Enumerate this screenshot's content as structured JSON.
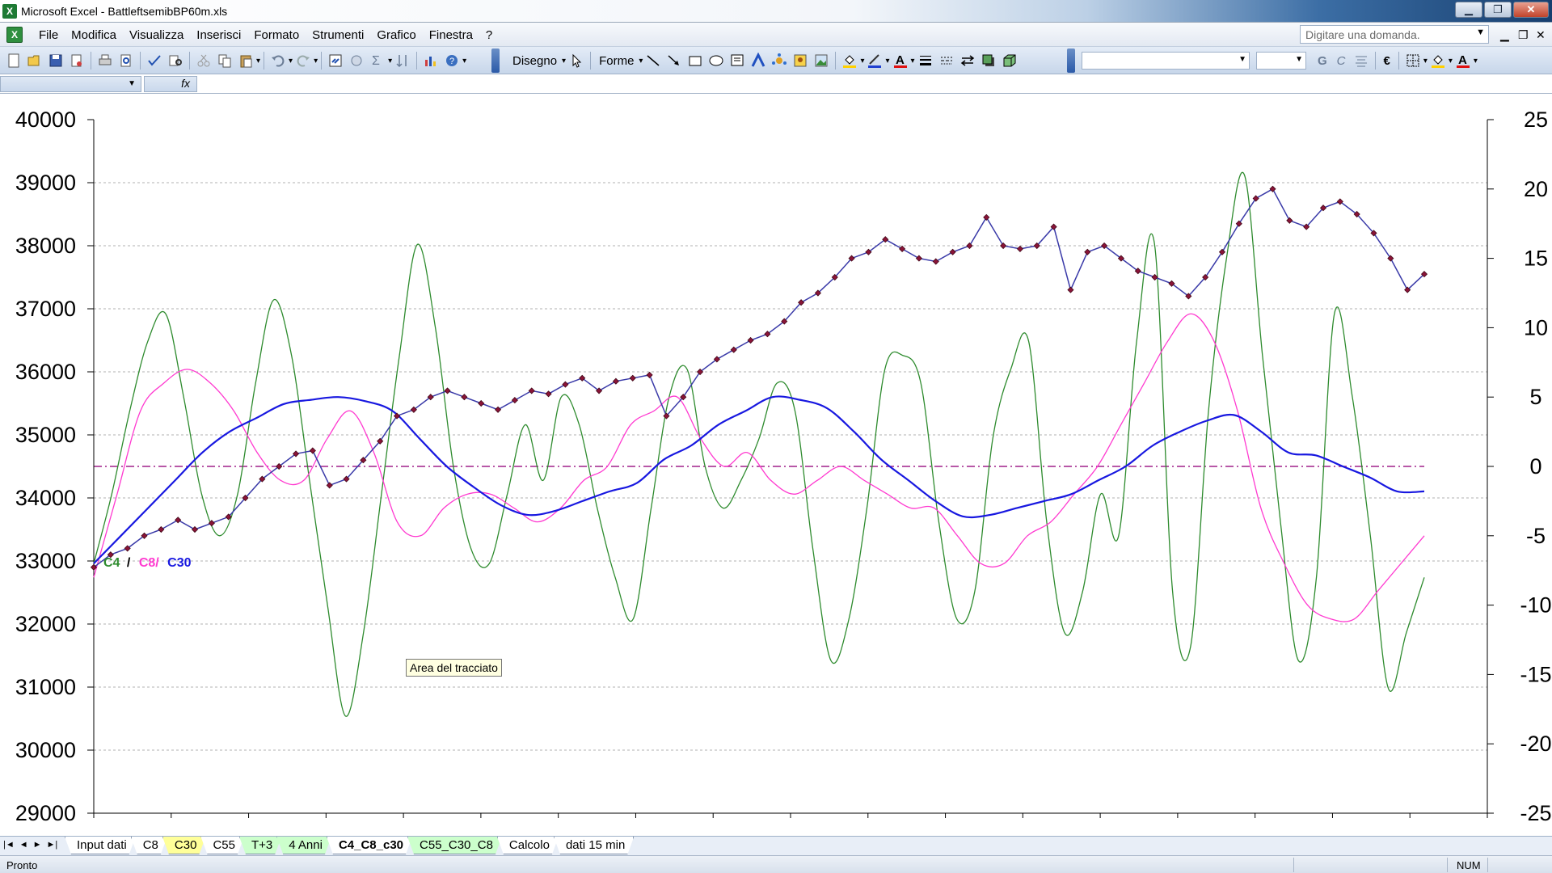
{
  "window": {
    "title": "Microsoft Excel - BattleftsemibBP60m.xls",
    "minimize": "▁",
    "restore": "❐",
    "close": "✕"
  },
  "menu": {
    "items": [
      "File",
      "Modifica",
      "Visualizza",
      "Inserisci",
      "Formato",
      "Strumenti",
      "Grafico",
      "Finestra",
      "?"
    ],
    "ask_placeholder": "Digitare una domanda.",
    "doc_min": "▁",
    "doc_restore": "❐",
    "doc_close": "✕"
  },
  "toolbar": {
    "draw_label": "Disegno",
    "shapes_label": "Forme",
    "bold": "G",
    "italic": "C",
    "euro": "€",
    "font_a": "A"
  },
  "formula_bar": {
    "fx_label": "fx"
  },
  "chart": {
    "tooltip": "Area del tracciato",
    "legend": {
      "c4": "C4",
      "sep1": "/",
      "c8": "C8/",
      "c30": "C30"
    },
    "colors": {
      "price": "#8a1438",
      "price_line": "#3a3aa8",
      "c4": "#2e8b2e",
      "c8": "#ff3ad0",
      "c30": "#1818e0",
      "zero": "#a0208a"
    }
  },
  "chart_data": {
    "type": "line",
    "left_axis": {
      "min": 29000,
      "max": 40000,
      "step": 1000,
      "ticks": [
        "40000",
        "39000",
        "38000",
        "37000",
        "36000",
        "35000",
        "34000",
        "33000",
        "32000",
        "31000",
        "30000",
        "29000"
      ]
    },
    "right_axis": {
      "min": -25,
      "max": 25,
      "step": 5,
      "ticks": [
        "25",
        "20",
        "15",
        "10",
        "5",
        "0",
        "-5",
        "-10",
        "-15",
        "-20",
        "-25"
      ]
    },
    "grid": true,
    "zero_line": 0,
    "series": [
      {
        "name": "C4",
        "axis": "right",
        "values": [
          -7,
          -2,
          4,
          9,
          11,
          5,
          -2,
          -5,
          -2,
          6,
          12,
          8,
          -1,
          -10,
          -18,
          -12,
          -2,
          8,
          16,
          10,
          0,
          -6,
          -7,
          -2,
          3,
          -1,
          5,
          3,
          -3,
          -8,
          -11,
          -3,
          5,
          7,
          0,
          -3,
          -1,
          2,
          6,
          4,
          -6,
          -14,
          -11,
          -3,
          7,
          8,
          6,
          -4,
          -11,
          -9,
          2,
          7,
          9,
          -4,
          -12,
          -9,
          -2,
          -5,
          9,
          16,
          -9,
          -13,
          4,
          15,
          21,
          8,
          -4,
          -14,
          -8,
          11,
          5,
          -5,
          -16,
          -12,
          -8
        ]
      },
      {
        "name": "C8",
        "axis": "right",
        "values": [
          -8,
          -2,
          4,
          6,
          7,
          6,
          4,
          1,
          -1,
          -1,
          2,
          4,
          1,
          -4,
          -5,
          -3,
          -2,
          -2,
          -3,
          -4,
          -3,
          -1,
          0,
          3,
          4,
          5,
          2,
          0,
          1,
          -1,
          -2,
          -1,
          0,
          -1,
          -2,
          -3,
          -3,
          -5,
          -7,
          -7,
          -5,
          -4,
          -2,
          0,
          3,
          6,
          9,
          11,
          9,
          4,
          -3,
          -7,
          -10,
          -11,
          -11,
          -9,
          -7,
          -5
        ]
      },
      {
        "name": "C30",
        "axis": "right",
        "values": [
          -7,
          -5,
          -3,
          -1,
          1,
          2.5,
          3.5,
          4.5,
          4.8,
          5,
          4.7,
          4,
          2,
          0,
          -1.5,
          -2.8,
          -3.5,
          -3.2,
          -2.5,
          -1.8,
          -1.2,
          0.5,
          1.5,
          3,
          4,
          5,
          4.8,
          4.2,
          2.5,
          0.5,
          -1,
          -2.5,
          -3.6,
          -3.5,
          -3,
          -2.5,
          -2,
          -1,
          0,
          1.5,
          2.5,
          3.3,
          3.7,
          2.5,
          1,
          0.8,
          0,
          -0.8,
          -1.8,
          -1.8
        ]
      },
      {
        "name": "Prezzo",
        "axis": "left",
        "values": [
          32900,
          33100,
          33200,
          33400,
          33500,
          33650,
          33500,
          33600,
          33700,
          34000,
          34300,
          34500,
          34700,
          34750,
          34200,
          34300,
          34600,
          34900,
          35300,
          35400,
          35600,
          35700,
          35600,
          35500,
          35400,
          35550,
          35700,
          35650,
          35800,
          35900,
          35700,
          35850,
          35900,
          35950,
          35300,
          35600,
          36000,
          36200,
          36350,
          36500,
          36600,
          36800,
          37100,
          37250,
          37500,
          37800,
          37900,
          38100,
          37950,
          37800,
          37750,
          37900,
          38000,
          38450,
          38000,
          37950,
          38000,
          38300,
          37300,
          37900,
          38000,
          37800,
          37600,
          37500,
          37400,
          37200,
          37500,
          37900,
          38350,
          38750,
          38900,
          38400,
          38300,
          38600,
          38700,
          38500,
          38200,
          37800,
          37300,
          37550
        ]
      }
    ]
  },
  "sheet_tabs": {
    "items": [
      {
        "label": "Input dati",
        "style": "white"
      },
      {
        "label": "C8",
        "style": "white"
      },
      {
        "label": "C30",
        "style": "yellow"
      },
      {
        "label": "C55",
        "style": "white"
      },
      {
        "label": "T+3",
        "style": "green"
      },
      {
        "label": "4 Anni",
        "style": "green"
      },
      {
        "label": "C4_C8_c30",
        "style": "active"
      },
      {
        "label": "C55_C30_C8",
        "style": "green"
      },
      {
        "label": "Calcolo",
        "style": "white"
      },
      {
        "label": "dati 15 min",
        "style": "white"
      }
    ],
    "nav": [
      "|◄",
      "◄",
      "►",
      "►|"
    ]
  },
  "status": {
    "text": "Pronto",
    "num": "NUM"
  }
}
